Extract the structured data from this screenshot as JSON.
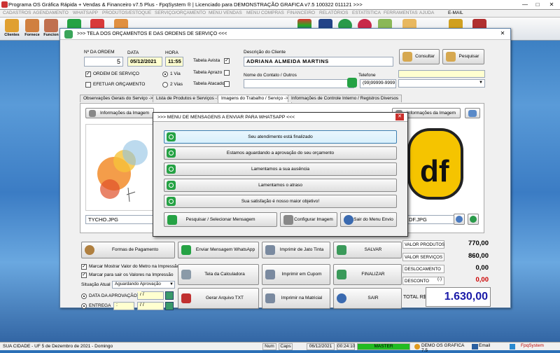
{
  "window": {
    "title": "Programa OS Gráfica Rápida + Vendas & Financeiro v7.5 Plus - FpqSystem ® | Licenciado para  DEMONSTRAÇÃO GRAFICA v7.5 100322 011121 >>>",
    "minimize": "—",
    "maximize": "□",
    "close": "✕"
  },
  "menu": [
    "CADASTROS",
    "AGENDAMENTO",
    "WHATSAPP",
    "PRODUTOS/ESTOQUE",
    "SERVIÇO/ORÇAMENTO",
    "MENU VENDAS",
    "MENU COMPRAS",
    "FINANCEIRO",
    "RELATÓRIOS",
    "ESTATÍSTICA",
    "FERRAMENTAS",
    "AJUDA",
    "E-MAIL"
  ],
  "toolbar": [
    "Clientes",
    "Fornece",
    "Funcion"
  ],
  "form": {
    "title": ">>>  TELA DOS ORÇAMENTOS E DAS ORDENS DE SERVIÇO  <<<",
    "order_label": "Nº DA ORDEM",
    "order_value": "5",
    "date_label": "DATA",
    "date_value": "05/12/2021",
    "time_label": "HORA",
    "time_value": "11:55",
    "tabela_avista": "Tabela Avista",
    "tabela_aprazo": "Tabela Aprazo",
    "tabela_atacado": "Tabela Atacado",
    "ordem_servico": "ORDEM DE SERVIÇO",
    "efetuar_orcamento": "EFETUAR ORÇAMENTO",
    "via1": "1 Via",
    "via2": "2 Vias",
    "desc_cliente_label": "Descrição do Cliente",
    "desc_cliente_value": "ADRIANA ALMEIDA MARTINS",
    "contato_label": "Nome do Contato / Outros",
    "telefone_label": "Telefone",
    "telefone_value": "(99)99999-9999",
    "consultar": "Consultar",
    "pesquisar": "Pesquisar"
  },
  "tabs": [
    "Observações Gerais do Serviço ->",
    "Lista de Produtos e Serviços ->",
    "Imagens do Trabalho / Serviço ->",
    "Informações de Controle Interno / Registros Diversos"
  ],
  "images": {
    "info_label": "Informações da Imagem",
    "file1": "TYCHO.JPG",
    "file2": "DF.JPG"
  },
  "dialog": {
    "title": ">>> MENU DE MENSAGENS A ENVIAR PARA WHATSAPP <<<",
    "close": "✕",
    "messages": [
      "Seu atendimento está finalizado",
      "Estamos aguardando a aprovação do seu orçamento",
      "Lamentamos a sua ausência",
      "Lamentamos o atraso",
      "Sua satisfação é nosso maior objetivo!"
    ],
    "search": "Pesquisar / Selecionar Mensagem",
    "configure": "Configurar Imagem",
    "exit": "Sair do Menu Envio"
  },
  "bottom": {
    "formas": "Formas de Pagamento",
    "whatsapp": "Enviar Mensagem WhatsApp",
    "imprimir_jato": "Imprimir de Jato Tinta",
    "salvar": "SALVAR",
    "tela_calc": "Tela da Calculadora",
    "imprimir_cupom": "Imprimir em Cupom",
    "finalizar": "FINALIZAR",
    "gerar_txt": "Gerar Arquivo TXT",
    "imprimir_matricial": "Imprimir na Matricial",
    "sair": "SAIR",
    "chk_metro": "Marcar Mostrar Valor do Metro na Impressão",
    "chk_sair": "Marcar para sair os Valores na Impressão",
    "situacao_label": "Situação Atual",
    "situacao_value": "Aguardando Aprovação",
    "data_aprov": "DATA DA APROVAÇÃO",
    "entrega": "ENTREGA",
    "date_blank": "  /  /",
    "time_blank": "  :"
  },
  "totals": {
    "valor_produtos_label": "VALOR PRODUTOS",
    "valor_produtos": "770,00",
    "valor_servicos_label": "VALOR SERVIÇOS",
    "valor_servicos": "860,00",
    "deslocamento_label": "DESLOCAMENTO",
    "deslocamento": "0,00",
    "desconto_label": "DESCONTO",
    "desconto_flag": "(-)",
    "desconto": "0,00",
    "total_label": "TOTAL R$",
    "total": "1.630,00"
  },
  "status": {
    "left": "SUA CIDADE - UF  5 de Dezembro de 2021 - Domingo",
    "num": "Num",
    "caps": "Caps",
    "date": "06/12/2021",
    "time": "00:24:10",
    "master": "MASTER",
    "demo": "DEMO OS GRAFICA 7.5",
    "email": "Email",
    "brand": "FpqSystem"
  }
}
